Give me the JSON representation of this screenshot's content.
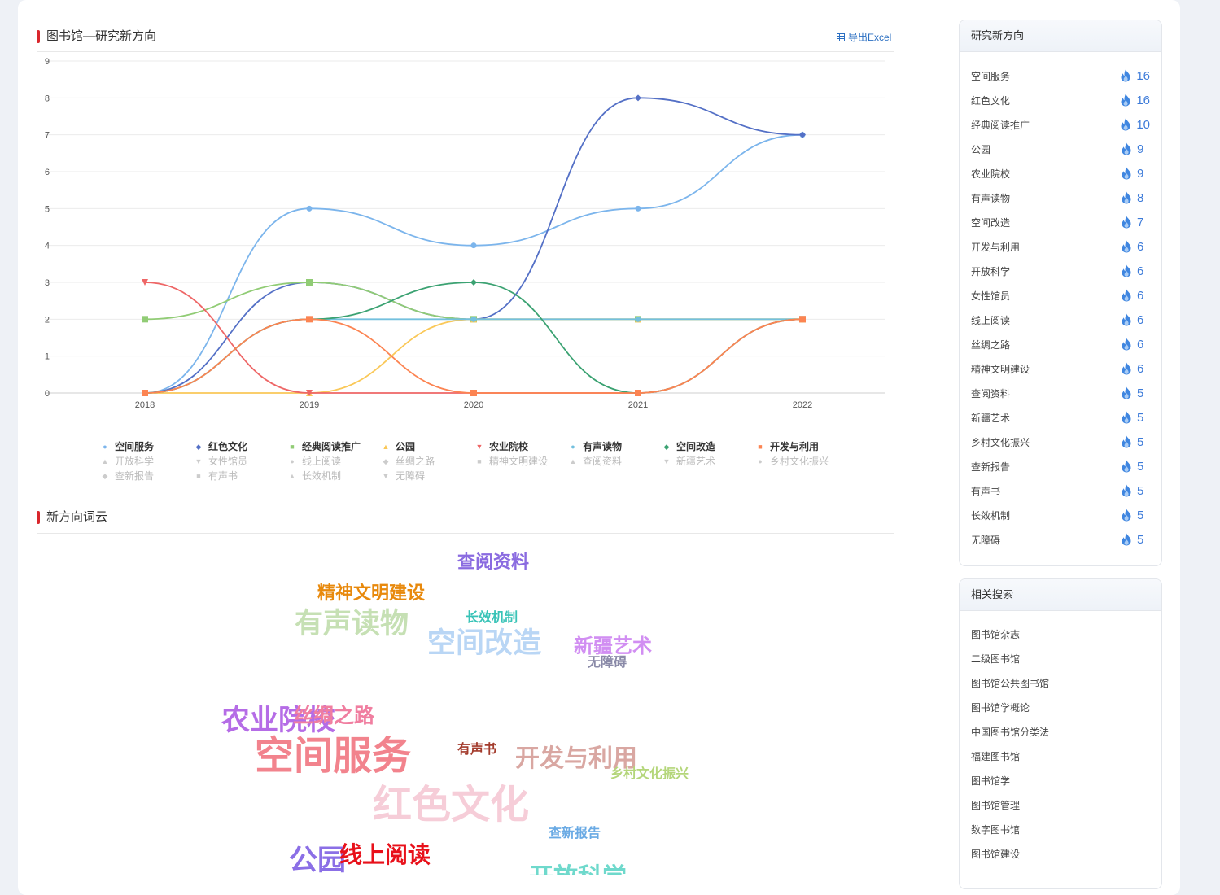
{
  "section1": {
    "title": "图书馆—研究新方向",
    "export_label": "导出Excel"
  },
  "section2": {
    "title": "新方向词云"
  },
  "chart_data": {
    "type": "line",
    "x": [
      "2018",
      "2019",
      "2020",
      "2021",
      "2022"
    ],
    "ylim": [
      0,
      9
    ],
    "yticks": [
      0,
      1,
      2,
      3,
      4,
      5,
      6,
      7,
      8,
      9
    ],
    "grid": true,
    "legend_position": "bottom",
    "series": [
      {
        "name": "空间服务",
        "values": [
          0,
          5,
          4,
          5,
          7
        ],
        "color": "#7cb5ec",
        "marker": "circle"
      },
      {
        "name": "红色文化",
        "values": [
          0,
          3,
          2,
          8,
          7
        ],
        "color": "#5470c6",
        "marker": "diamond"
      },
      {
        "name": "经典阅读推广",
        "values": [
          2,
          3,
          2,
          2,
          2
        ],
        "color": "#91cc75",
        "marker": "square"
      },
      {
        "name": "公园",
        "values": [
          0,
          0,
          2,
          2,
          2
        ],
        "color": "#fac858",
        "marker": "triangle"
      },
      {
        "name": "农业院校",
        "values": [
          3,
          0,
          0,
          0,
          2
        ],
        "color": "#ee6666",
        "marker": "triangle-down"
      },
      {
        "name": "有声读物",
        "values": [
          0,
          2,
          2,
          2,
          2
        ],
        "color": "#73c0de",
        "marker": "circle"
      },
      {
        "name": "空间改造",
        "values": [
          0,
          2,
          3,
          0,
          2
        ],
        "color": "#3ba272",
        "marker": "diamond"
      },
      {
        "name": "开发与利用",
        "values": [
          0,
          2,
          0,
          0,
          2
        ],
        "color": "#fc8452",
        "marker": "square"
      }
    ],
    "inactive_legend": [
      {
        "name": "开放科学",
        "marker": "triangle"
      },
      {
        "name": "女性馆员",
        "marker": "triangle-down"
      },
      {
        "name": "线上阅读",
        "marker": "circle"
      },
      {
        "name": "丝绸之路",
        "marker": "diamond"
      },
      {
        "name": "精神文明建设",
        "marker": "square"
      },
      {
        "name": "查阅资料",
        "marker": "triangle"
      },
      {
        "name": "新疆艺术",
        "marker": "triangle-down"
      },
      {
        "name": "乡村文化振兴",
        "marker": "circle"
      },
      {
        "name": "查新报告",
        "marker": "diamond"
      },
      {
        "name": "有声书",
        "marker": "square"
      },
      {
        "name": "长效机制",
        "marker": "triangle"
      },
      {
        "name": "无障碍",
        "marker": "triangle-down"
      }
    ]
  },
  "wordcloud": {
    "words": [
      {
        "text": "查阅资料",
        "color": "#8a6be0"
      },
      {
        "text": "精神文明建设",
        "color": "#e8890c"
      },
      {
        "text": "长效机制",
        "color": "#38c3b7"
      },
      {
        "text": "有声读物",
        "color": "#c6e0b4"
      },
      {
        "text": "空间改造",
        "color": "#b9d6f5"
      },
      {
        "text": "新疆艺术",
        "color": "#d18ef2"
      },
      {
        "text": "无障碍",
        "color": "#8a8aa8"
      },
      {
        "text": "农业院校",
        "color": "#b56ce6"
      },
      {
        "text": "丝绸之路",
        "color": "#f07ea0"
      },
      {
        "text": "空间服务",
        "color": "#f2838d"
      },
      {
        "text": "有声书",
        "color": "#a33b2c"
      },
      {
        "text": "开发与利用",
        "color": "#d9a7a2"
      },
      {
        "text": "乡村文化振兴",
        "color": "#b4d67a"
      },
      {
        "text": "红色文化",
        "color": "#f6cdd8"
      },
      {
        "text": "查新报告",
        "color": "#6aaae4"
      },
      {
        "text": "公园",
        "color": "#8b6fe6"
      },
      {
        "text": "线上阅读",
        "color": "#e8101a"
      },
      {
        "text": "开放科学",
        "color": "#6fd9cc"
      }
    ]
  },
  "sidebar": {
    "title": "研究新方向",
    "items": [
      {
        "label": "空间服务",
        "count": "16"
      },
      {
        "label": "红色文化",
        "count": "16"
      },
      {
        "label": "经典阅读推广",
        "count": "10"
      },
      {
        "label": "公园",
        "count": "9"
      },
      {
        "label": "农业院校",
        "count": "9"
      },
      {
        "label": "有声读物",
        "count": "8"
      },
      {
        "label": "空间改造",
        "count": "7"
      },
      {
        "label": "开发与利用",
        "count": "6"
      },
      {
        "label": "开放科学",
        "count": "6"
      },
      {
        "label": "女性馆员",
        "count": "6"
      },
      {
        "label": "线上阅读",
        "count": "6"
      },
      {
        "label": "丝绸之路",
        "count": "6"
      },
      {
        "label": "精神文明建设",
        "count": "6"
      },
      {
        "label": "查阅资料",
        "count": "5"
      },
      {
        "label": "新疆艺术",
        "count": "5"
      },
      {
        "label": "乡村文化振兴",
        "count": "5"
      },
      {
        "label": "查新报告",
        "count": "5"
      },
      {
        "label": "有声书",
        "count": "5"
      },
      {
        "label": "长效机制",
        "count": "5"
      },
      {
        "label": "无障碍",
        "count": "5"
      }
    ]
  },
  "related": {
    "title": "相关搜索",
    "items": [
      "图书馆杂志",
      "二级图书馆",
      "图书馆公共图书馆",
      "图书馆学概论",
      "中国图书馆分类法",
      "福建图书馆",
      "图书馆学",
      "图书馆管理",
      "数字图书馆",
      "图书馆建设"
    ]
  }
}
